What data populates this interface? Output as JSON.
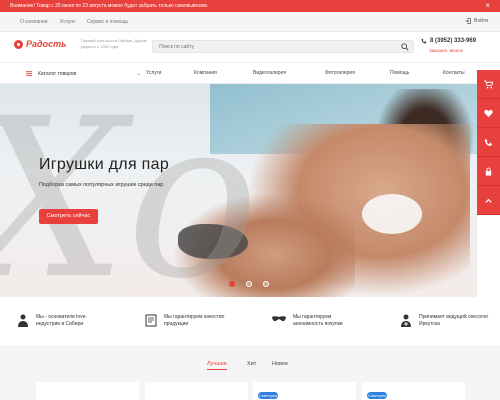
{
  "alert": {
    "text": "Внимание! Товар с 25 июня по 23 августа можно будет забрать только самовывозом.",
    "close": "×"
  },
  "util": {
    "links": [
      "О компании",
      "Услуги",
      "Сервис и помощь"
    ],
    "login": "Войти"
  },
  "header": {
    "logo": "Радость",
    "tagline": "Первый секс-шоп в Сибири. Дарим радость с 1992 года",
    "search_placeholder": "Поиск по сайту",
    "phone": "8 (3952) 333-969",
    "callback": "Заказать звонок"
  },
  "nav": {
    "catalog": "Каталог товаров",
    "items": [
      "Услуги",
      "Компания",
      "Видеогалерея",
      "Фотогалерея",
      "Помощь",
      "Контакты"
    ]
  },
  "hero": {
    "watermark": "Xo",
    "title": "Игрушки для пар",
    "subtitle": "Подборка самых популярных игрушек среди пар",
    "cta": "Смотреть сейчас",
    "slides_total": 3,
    "active_slide": 1
  },
  "features": [
    {
      "icon": "person-icon",
      "text": "Мы - основатели love-индустрии в Сибири"
    },
    {
      "icon": "certificate-icon",
      "text": "Мы гарантируем качество продукции"
    },
    {
      "icon": "mask-icon",
      "text": "Мы гарантируем анонимность покупки"
    },
    {
      "icon": "doctor-icon",
      "text": "Принимает ведущий сексолог Иркутска"
    }
  ],
  "tabs": [
    "Лучшее",
    "Хит",
    "Новое"
  ],
  "active_tab": "Лучшее",
  "badges": [
    "Советуем",
    "Советуем"
  ],
  "side_panel": [
    "cart-icon",
    "heart-icon",
    "phone-icon",
    "lock-icon",
    "chevron-up-icon"
  ],
  "colors": {
    "accent": "#e8413d",
    "badge": "#2f7fe0"
  }
}
